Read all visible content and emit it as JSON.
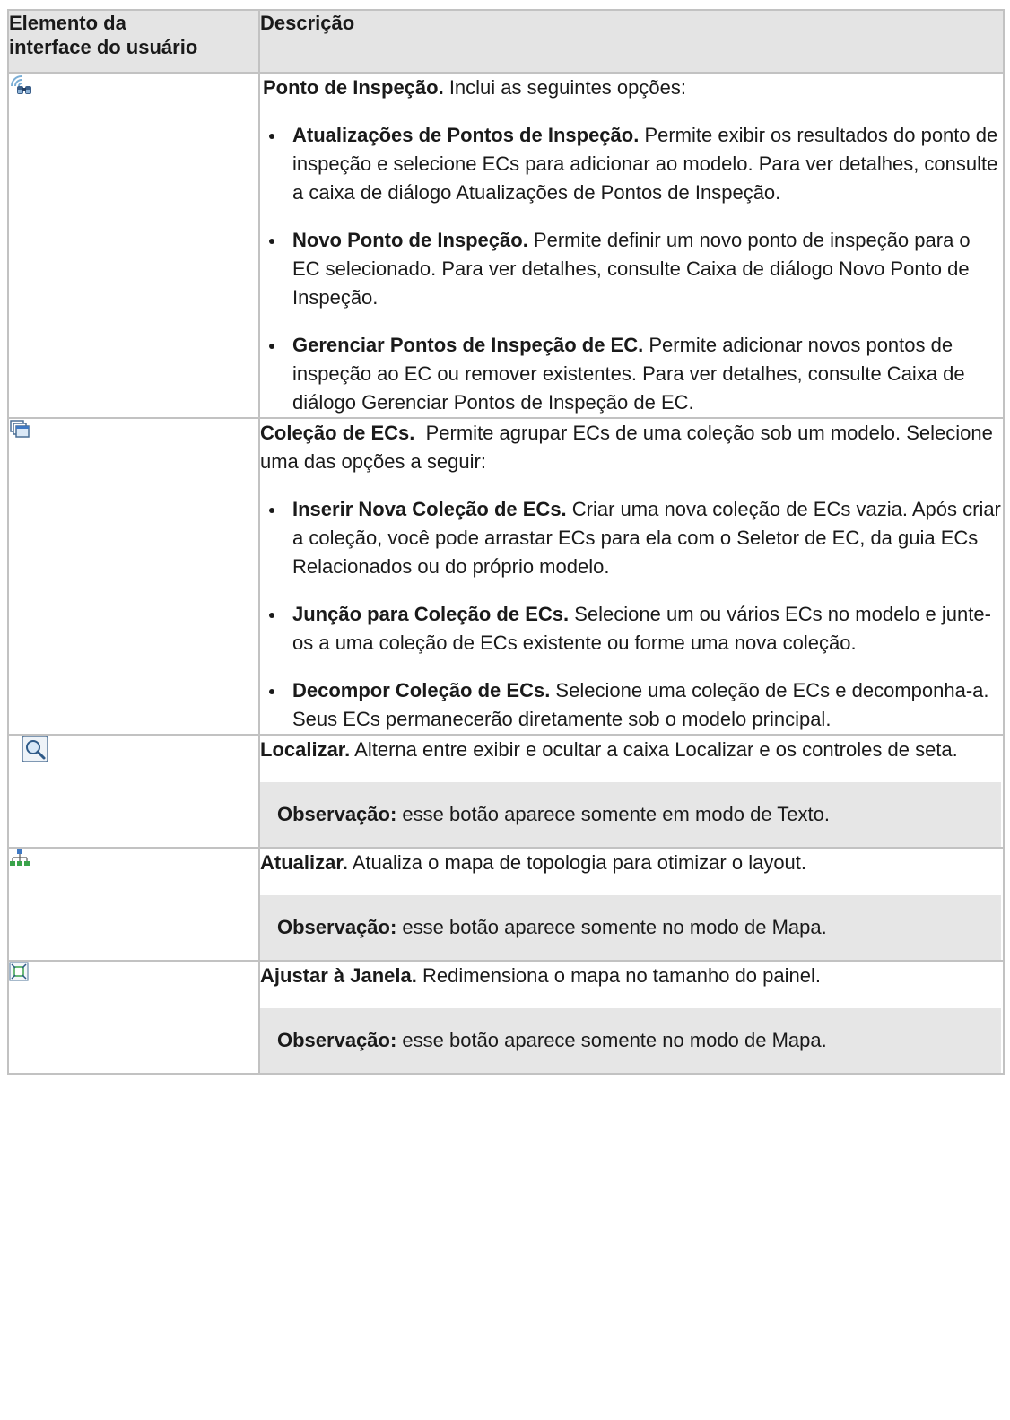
{
  "table": {
    "header_col1": "Elemento da interface do usuário",
    "header_col1_line1": "Elemento da",
    "header_col1_line2": "interface do usuário",
    "header_col2": "Descrição"
  },
  "rows": [
    {
      "icon": "checkpoint-binoculars-icon",
      "title": "Ponto de Inspeção.",
      "text": " Inclui as seguintes opções:",
      "items": [
        {
          "title": "Atualizações de Pontos de Inspeção.",
          "text": " Permite exibir os resultados do ponto de inspeção e selecione ECs para adicionar ao modelo. Para ver detalhes, consulte a caixa de diálogo Atualizações de Pontos de Inspeção."
        },
        {
          "title": "Novo Ponto de Inspeção.",
          "text": " Permite definir um novo ponto de inspeção para o EC selecionado. Para ver detalhes, consulte Caixa de diálogo Novo Ponto de Inspeção."
        },
        {
          "title": "Gerenciar Pontos de Inspeção de EC.",
          "text": " Permite adicionar novos pontos de inspeção ao EC ou remover existentes. Para ver detalhes, consulte Caixa de diálogo Gerenciar Pontos de Inspeção de EC."
        }
      ]
    },
    {
      "icon": "ci-collection-icon",
      "title": "Coleção de ECs.",
      "text": "  Permite agrupar ECs de uma coleção sob um modelo. Selecione uma das opções a seguir:",
      "items": [
        {
          "title": "Inserir Nova Coleção de ECs.",
          "text": " Criar uma nova coleção de ECs vazia. Após criar a coleção, você pode arrastar ECs para ela com o Seletor de EC, da guia ECs Relacionados ou do próprio modelo."
        },
        {
          "title": "Junção para Coleção de ECs.",
          "text": " Selecione um ou vários ECs no modelo e junte-os a uma coleção de ECs existente ou forme uma nova coleção."
        },
        {
          "title": "Decompor Coleção de ECs.",
          "text": " Selecione uma coleção de ECs e decomponha-a. Seus ECs permanecerão diretamente sob o modelo principal."
        }
      ]
    },
    {
      "icon": "find-magnifier-icon",
      "title": "Localizar.",
      "text": " Alterna entre exibir e ocultar a caixa Localizar e os controles de seta.",
      "note_label": "Observação:",
      "note_text": " esse botão aparece somente em modo de Texto."
    },
    {
      "icon": "topology-layout-icon",
      "title": "Atualizar.",
      "text": " Atualiza o mapa de topologia para otimizar o layout.",
      "note_label": "Observação:",
      "note_text": " esse botão aparece somente no modo de Mapa."
    },
    {
      "icon": "fit-to-window-icon",
      "title": "Ajustar à Janela.",
      "text": " Redimensiona o mapa no tamanho do painel.",
      "note_label": "Observação:",
      "note_text": " esse botão aparece somente no modo de Mapa."
    }
  ]
}
